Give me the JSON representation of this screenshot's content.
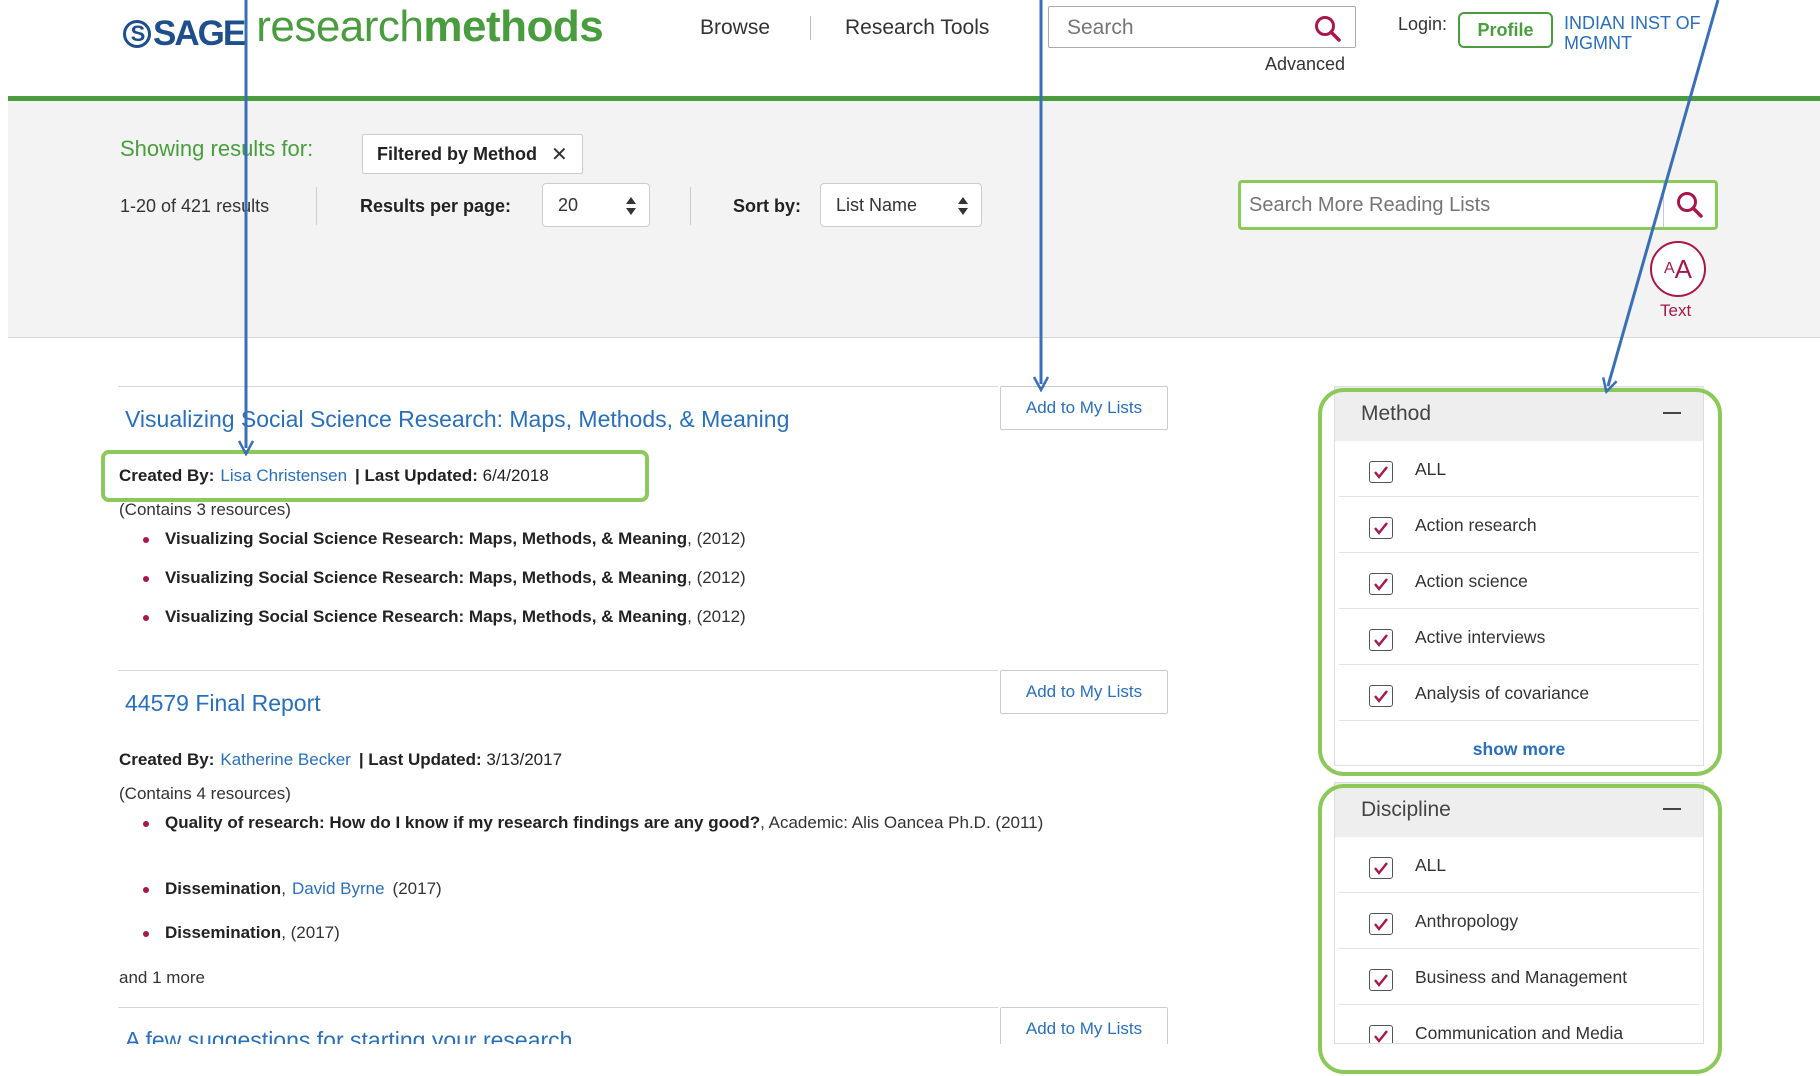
{
  "header": {
    "logo_sage": "SAGE",
    "logo_research": "research",
    "logo_methods": "methods",
    "nav_browse": "Browse",
    "nav_research_tools": "Research Tools",
    "search_placeholder": "Search",
    "advanced": "Advanced",
    "login_label": "Login:",
    "profile": "Profile",
    "institution": "INDIAN INST OF MGMNT"
  },
  "results_bar": {
    "showing_label": "Showing results for:",
    "filter_chip": "Filtered by Method",
    "count": "1-20 of 421 results",
    "rpp_label": "Results per page:",
    "rpp_value": "20",
    "sort_label": "Sort by:",
    "sort_value": "List Name",
    "reading_search_placeholder": "Search More Reading Lists",
    "text_size_label": "Text"
  },
  "lists": [
    {
      "title": "Visualizing Social Science Research: Maps, Methods, & Meaning",
      "add_label": "Add to My Lists",
      "created_by_label": "Created By:",
      "author": "Lisa Christensen",
      "updated_label": "| Last Updated:",
      "updated": "6/4/2018",
      "contains": "(Contains 3 resources)",
      "resources": [
        {
          "title": "Visualizing Social Science Research: Maps, Methods, & Meaning",
          "rest": ", (2012)"
        },
        {
          "title": "Visualizing Social Science Research: Maps, Methods, & Meaning",
          "rest": ", (2012)"
        },
        {
          "title": "Visualizing Social Science Research: Maps, Methods, & Meaning",
          "rest": ", (2012)"
        }
      ]
    },
    {
      "title": "44579 Final Report",
      "add_label": "Add to My Lists",
      "created_by_label": "Created By:",
      "author": "Katherine Becker",
      "updated_label": "| Last Updated:",
      "updated": "3/13/2017",
      "contains": "(Contains 4 resources)",
      "resources": [
        {
          "title": "Quality of research: How do I know if my research findings are any good?",
          "rest": ", Academic: Alis Oancea Ph.D. (2011)"
        },
        {
          "title": "Dissemination",
          "sep": ",",
          "author": "David Byrne",
          "rest": "(2017)"
        },
        {
          "title": "Dissemination",
          "rest": ", (2017)"
        }
      ],
      "and_more": "and 1 more"
    },
    {
      "title": "A few suggestions for starting your research",
      "add_label": "Add to My Lists"
    }
  ],
  "facets": {
    "method": {
      "title": "Method",
      "items": [
        "ALL",
        "Action research",
        "Action science",
        "Active interviews",
        "Analysis of covariance"
      ],
      "show_more": "show more"
    },
    "discipline": {
      "title": "Discipline",
      "items": [
        "ALL",
        "Anthropology",
        "Business and Management",
        "Communication and Media"
      ]
    }
  },
  "colors": {
    "brand_green": "#4a9d3f",
    "highlight_green": "#8dc85b",
    "link_blue": "#2a6fb8",
    "accent_crimson": "#a6174a",
    "arrow_blue": "#3a6fb5"
  }
}
